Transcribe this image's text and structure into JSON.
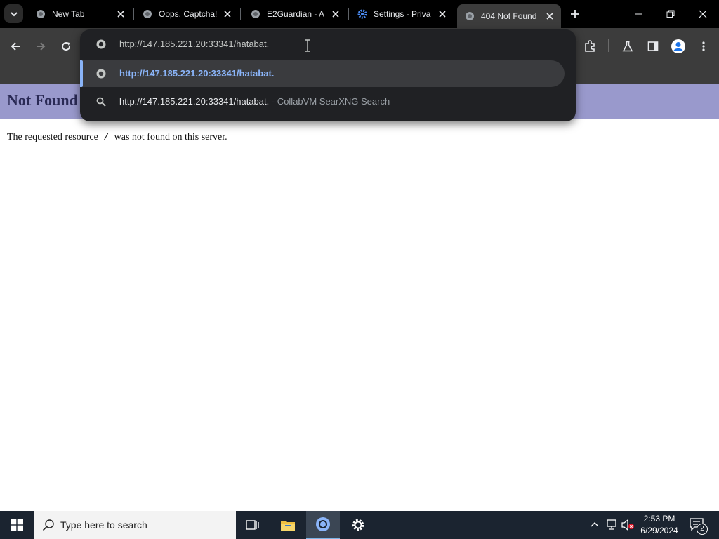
{
  "browser": {
    "tabs": [
      {
        "title": "New Tab",
        "icon": "globe-icon",
        "active": false
      },
      {
        "title": "Oops, Captcha!",
        "icon": "globe-icon",
        "active": false
      },
      {
        "title": "E2Guardian - A",
        "icon": "globe-icon",
        "active": false
      },
      {
        "title": "Settings - Priva",
        "icon": "gear-icon",
        "active": false
      },
      {
        "title": "404 Not Found",
        "icon": "globe-icon",
        "active": true
      }
    ],
    "omnibox": {
      "value": "http://147.185.221.20:33341/hatabat.",
      "suggestions": [
        {
          "url": "http://147.185.221.20:33341/hatabat.",
          "description": "",
          "icon": "globe-icon",
          "selected": true
        },
        {
          "url": "http://147.185.221.20:33341/hatabat.",
          "description": " - CollabVM SearXNG Search",
          "icon": "search-icon",
          "selected": false
        }
      ]
    }
  },
  "page": {
    "heading": "Not Found",
    "message_before": "The requested resource",
    "resource": "/",
    "message_after": "was not found on this server."
  },
  "taskbar": {
    "search_placeholder": "Type here to search",
    "time": "2:53 PM",
    "date": "6/29/2024",
    "notification_count": "2"
  },
  "colors": {
    "header_bg": "#9999cc",
    "accent": "#8ab4f8",
    "toolbar": "#3c3c3c"
  }
}
